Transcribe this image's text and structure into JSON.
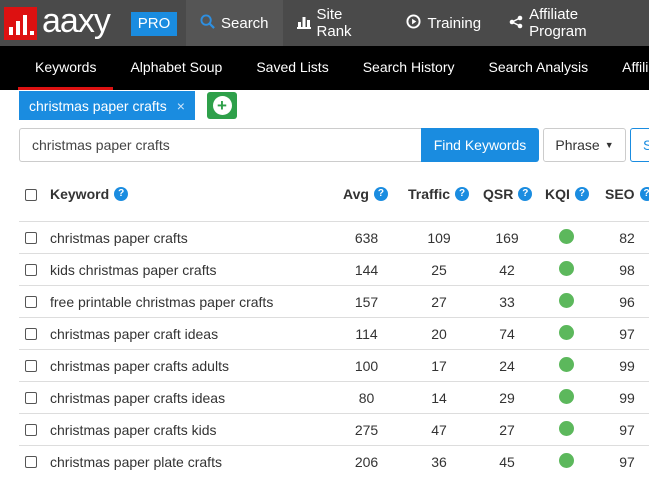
{
  "brand": {
    "logo_text": "aaxy",
    "badge": "PRO"
  },
  "topnav": [
    {
      "label": "Search",
      "icon": "search-icon",
      "active": true
    },
    {
      "label": "Site Rank",
      "icon": "bar-chart-icon",
      "active": false
    },
    {
      "label": "Training",
      "icon": "play-circle-icon",
      "active": false
    },
    {
      "label": "Affiliate Program",
      "icon": "share-icon",
      "active": false
    }
  ],
  "subnav": [
    {
      "label": "Keywords",
      "active": true
    },
    {
      "label": "Alphabet Soup",
      "active": false
    },
    {
      "label": "Saved Lists",
      "active": false
    },
    {
      "label": "Search History",
      "active": false
    },
    {
      "label": "Search Analysis",
      "active": false
    },
    {
      "label": "Affiliate",
      "active": false
    }
  ],
  "search_tag": {
    "label": "christmas paper crafts",
    "close": "×"
  },
  "search": {
    "value": "christmas paper crafts",
    "find_button": "Find Keywords",
    "phrase_button": "Phrase",
    "cut_button": "S"
  },
  "table": {
    "headers": {
      "keyword": "Keyword",
      "avg": "Avg",
      "traffic": "Traffic",
      "qsr": "QSR",
      "kqi": "KQI",
      "seo": "SEO"
    },
    "help_glyph": "?",
    "rows": [
      {
        "keyword": "christmas paper crafts",
        "avg": "638",
        "traffic": "109",
        "qsr": "169",
        "kqi": "green",
        "seo": "82"
      },
      {
        "keyword": "kids christmas paper crafts",
        "avg": "144",
        "traffic": "25",
        "qsr": "42",
        "kqi": "green",
        "seo": "98"
      },
      {
        "keyword": "free printable christmas paper crafts",
        "avg": "157",
        "traffic": "27",
        "qsr": "33",
        "kqi": "green",
        "seo": "96"
      },
      {
        "keyword": "christmas paper craft ideas",
        "avg": "114",
        "traffic": "20",
        "qsr": "74",
        "kqi": "green",
        "seo": "97"
      },
      {
        "keyword": "christmas paper crafts adults",
        "avg": "100",
        "traffic": "17",
        "qsr": "24",
        "kqi": "green",
        "seo": "99"
      },
      {
        "keyword": "christmas paper crafts ideas",
        "avg": "80",
        "traffic": "14",
        "qsr": "29",
        "kqi": "green",
        "seo": "99"
      },
      {
        "keyword": "christmas paper crafts kids",
        "avg": "275",
        "traffic": "47",
        "qsr": "27",
        "kqi": "green",
        "seo": "97"
      },
      {
        "keyword": "christmas paper plate crafts",
        "avg": "206",
        "traffic": "36",
        "qsr": "45",
        "kqi": "green",
        "seo": "97"
      }
    ]
  },
  "colors": {
    "accent_blue": "#1a8ce0",
    "brand_red": "#dd1111",
    "kqi_green": "#5cb85c",
    "add_green": "#2ea04a"
  }
}
